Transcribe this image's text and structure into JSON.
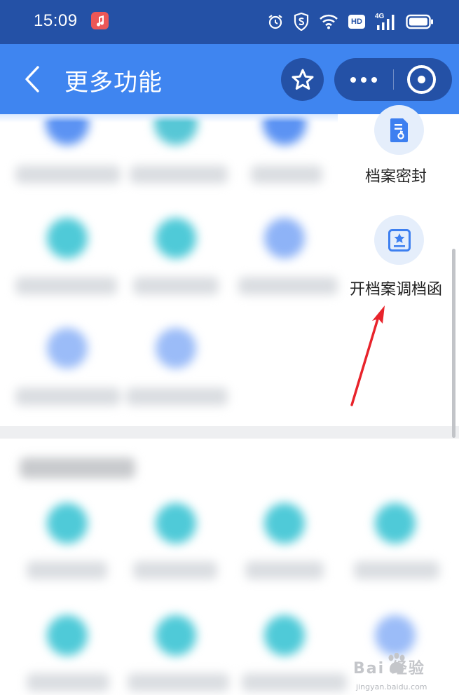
{
  "status_bar": {
    "time": "15:09",
    "icons": [
      "music-app-icon",
      "alarm-icon",
      "security-shield-icon",
      "wifi-icon",
      "hd-icon",
      "signal-4g-icon",
      "battery-icon"
    ],
    "hd_label": "HD",
    "network_label": "4G"
  },
  "nav": {
    "title": "更多功能",
    "back_icon": "chevron-left-icon",
    "favorite_icon": "star-icon",
    "more_icon": "more-dots-icon",
    "close_icon": "target-circle-icon"
  },
  "features": [
    {
      "label": "档案密封",
      "icon": "document-key-icon"
    },
    {
      "label": "开档案调档函",
      "icon": "document-star-icon"
    }
  ],
  "watermark": {
    "brand": "Bai 经验",
    "url": "jingyan.baidu.com"
  },
  "colors": {
    "status_bar": "#2451a6",
    "nav_bar": "#3f85f0",
    "icon_blue": "#3d7ff0",
    "icon_bg": "#e5eefb",
    "arrow": "#e8232b"
  }
}
